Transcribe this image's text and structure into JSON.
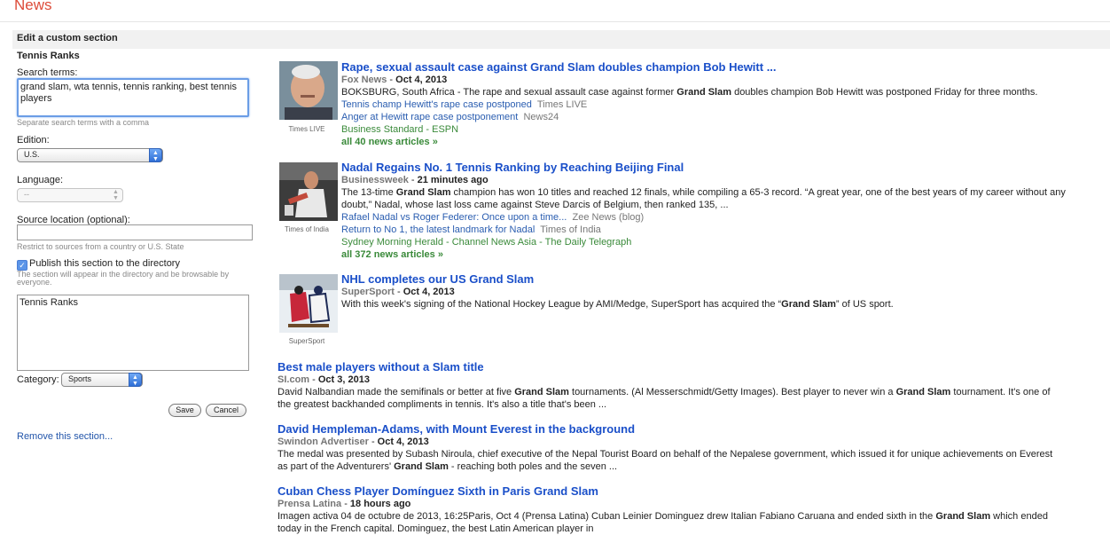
{
  "app": {
    "logo": "News"
  },
  "band": {
    "title": "Edit a custom section"
  },
  "form": {
    "section_name": "Tennis Ranks",
    "search_label": "Search terms:",
    "search_value": "grand slam, wta tennis, tennis ranking, best tennis players",
    "search_hint": "Separate search terms with a comma",
    "edition_label": "Edition:",
    "edition_value": "U.S.",
    "language_label": "Language:",
    "language_value": "--",
    "source_label": "Source location (optional):",
    "source_value": "",
    "source_hint": "Restrict to sources from a country or U.S. State",
    "publish_label": "Publish this section to the directory",
    "publish_checked": true,
    "publish_hint": "The section will appear in the directory and be browsable by everyone.",
    "description_value": "Tennis Ranks",
    "category_label": "Category:",
    "category_value": "Sports",
    "save_label": "Save",
    "cancel_label": "Cancel",
    "remove_label": "Remove this section..."
  },
  "results": [
    {
      "title": "Rape, sexual assault case against Grand Slam doubles champion Bob Hewitt ...",
      "source": "Fox News",
      "date": "Oct 4, 2013",
      "snippet_pre": "BOKSBURG, South Africa - The rape and sexual assault case against former ",
      "snippet_bold": "Grand Slam",
      "snippet_post": " doubles champion Bob Hewitt was postponed Friday for three months.",
      "related": [
        {
          "title": "Tennis champ Hewitt's rape case postponed",
          "source": "Times LIVE"
        },
        {
          "title": "Anger at Hewitt rape case postponement",
          "source": "News24"
        }
      ],
      "more_sources": "Business Standard - ESPN",
      "all_articles": "all 40 news articles »",
      "thumb_caption": "Times LIVE"
    },
    {
      "title": "Nadal Regains No. 1 Tennis Ranking by Reaching Beijing Final",
      "source": "Businessweek",
      "date": "21 minutes ago",
      "snippet_pre": "The 13-time ",
      "snippet_bold": "Grand Slam",
      "snippet_post": " champion has won 10 titles and reached 12 finals, while compiling a 65-3 record. “A great year, one of the best years of my career without any doubt,” Nadal, whose last loss came against Steve Darcis of Belgium, then ranked 135, ...",
      "related": [
        {
          "title": "Rafael Nadal vs Roger Federer: Once upon a time...",
          "source": "Zee News (blog)"
        },
        {
          "title": "Return to No 1, the latest landmark for Nadal",
          "source": "Times of India"
        }
      ],
      "more_sources": "Sydney Morning Herald - Channel News Asia - The Daily Telegraph",
      "all_articles": "all 372 news articles »",
      "thumb_caption": "Times of India"
    },
    {
      "title": "NHL completes our US Grand Slam",
      "source": "SuperSport",
      "date": "Oct 4, 2013",
      "snippet_pre": "With this week's signing of the National Hockey League by AMI/Medge, SuperSport has acquired the “",
      "snippet_bold": "Grand Slam",
      "snippet_post": "” of US sport.",
      "thumb_caption": "SuperSport"
    },
    {
      "title": "Best male players without a Slam title",
      "source": "SI.com",
      "date": "Oct 3, 2013",
      "snippet_html_parts": [
        "David Nalbandian made the semifinals or better at five ",
        "Grand Slam",
        " tournaments. (Al Messerschmidt/Getty Images). Best player to never win a ",
        "Grand Slam",
        " tournament. It's one of the greatest backhanded compliments in tennis. It's also a title that's been ..."
      ]
    },
    {
      "title": "David Hempleman-Adams, with Mount Everest in the background",
      "source": "Swindon Advertiser",
      "date": "Oct 4, 2013",
      "snippet_pre": "The medal was presented by Subash Niroula, chief executive of the Nepal Tourist Board on behalf of the Nepalese government, which issued it for unique achievements on Everest as part of the Adventurers' ",
      "snippet_bold": "Grand Slam",
      "snippet_post": " - reaching both poles and the seven ..."
    },
    {
      "title": "Cuban Chess Player Domínguez Sixth in Paris Grand Slam",
      "source": "Prensa Latina",
      "date": "18 hours ago",
      "snippet_pre": "Imagen activa 04 de octubre de 2013, 16:25Paris, Oct 4 (Prensa Latina) Cuban Leinier Dominguez drew Italian Fabiano Caruana and ended sixth in the ",
      "snippet_bold": "Grand Slam",
      "snippet_post": " which ended today in the French capital. Dominguez, the best Latin American player in"
    }
  ]
}
